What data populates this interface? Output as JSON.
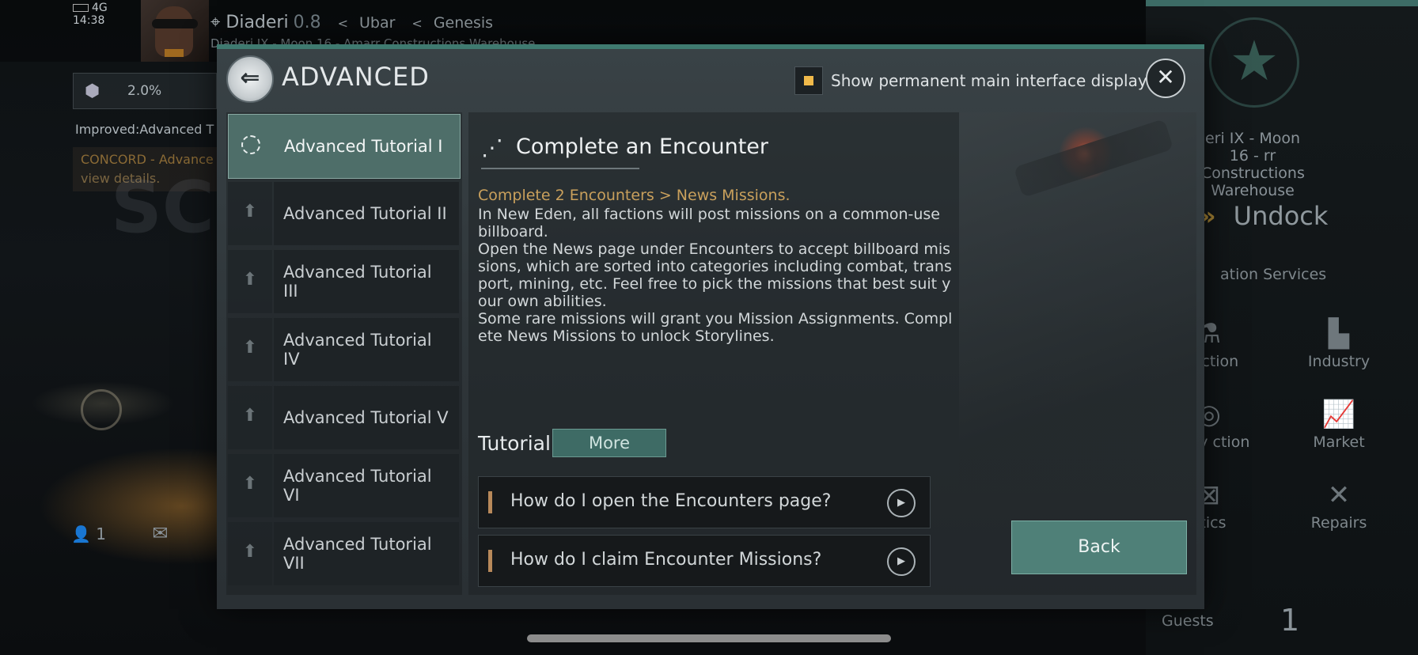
{
  "status_bar": {
    "network": "4G",
    "time": "14:38"
  },
  "location": {
    "system": "Diaderi",
    "security": "0.8",
    "region": "Ubar",
    "area": "Genesis",
    "station": "Diaderi IX - Moon 16 - Amarr Constructions Warehouse"
  },
  "hud": {
    "stat_value": "2.0%",
    "improved_text": "Improved:Advanced T",
    "concord_line1": "CONCORD - Advance",
    "concord_line2": "view details.",
    "bg_text": "SC",
    "contacts_count": "1"
  },
  "right_panel": {
    "station_name": "eri IX - Moon 16 - rr Constructions Warehouse",
    "undock": "Undock",
    "services_label": "ation Services",
    "tiles": [
      {
        "label": "se ction",
        "icon": "flask-icon"
      },
      {
        "label": "Industry",
        "icon": "factory-icon"
      },
      {
        "label": "etary ction",
        "icon": "planet-icon"
      },
      {
        "label": "Market",
        "icon": "chart-icon"
      },
      {
        "label": "stics",
        "icon": "logistics-icon"
      },
      {
        "label": "Repairs",
        "icon": "wrench-icon"
      }
    ],
    "guests_label": "Guests",
    "guests_count": "1"
  },
  "dialog": {
    "title": "ADVANCED",
    "toggle_label": "Show permanent main interface display",
    "toggle_checked": true,
    "accent_color": "#3f7a70",
    "tutorials": [
      {
        "label": "Advanced Tutorial I",
        "state": "active"
      },
      {
        "label": "Advanced Tutorial II",
        "state": "locked"
      },
      {
        "label": "Advanced Tutorial III",
        "state": "locked"
      },
      {
        "label": "Advanced Tutorial IV",
        "state": "locked"
      },
      {
        "label": "Advanced Tutorial V",
        "state": "locked"
      },
      {
        "label": "Advanced Tutorial VI",
        "state": "locked"
      },
      {
        "label": "Advanced Tutorial VII",
        "state": "locked"
      }
    ],
    "content": {
      "title": "Complete an Encounter",
      "objective": "Complete 2 Encounters > News Missions.",
      "description": "In New Eden, all factions will post missions on a common-use billboard.\nOpen the News page under Encounters to accept billboard missions, which are sorted into categories including combat, transport, mining, etc. Feel free to pick the missions that best suit your own abilities.\nSome rare missions will grant you Mission Assignments. Complete News Missions to unlock Storylines.",
      "tutorial_label": "Tutorial",
      "more_label": "More",
      "faqs": [
        {
          "question": "How do I open the Encounters page?"
        },
        {
          "question": "How do I claim Encounter Missions?"
        }
      ],
      "back_label": "Back"
    }
  }
}
